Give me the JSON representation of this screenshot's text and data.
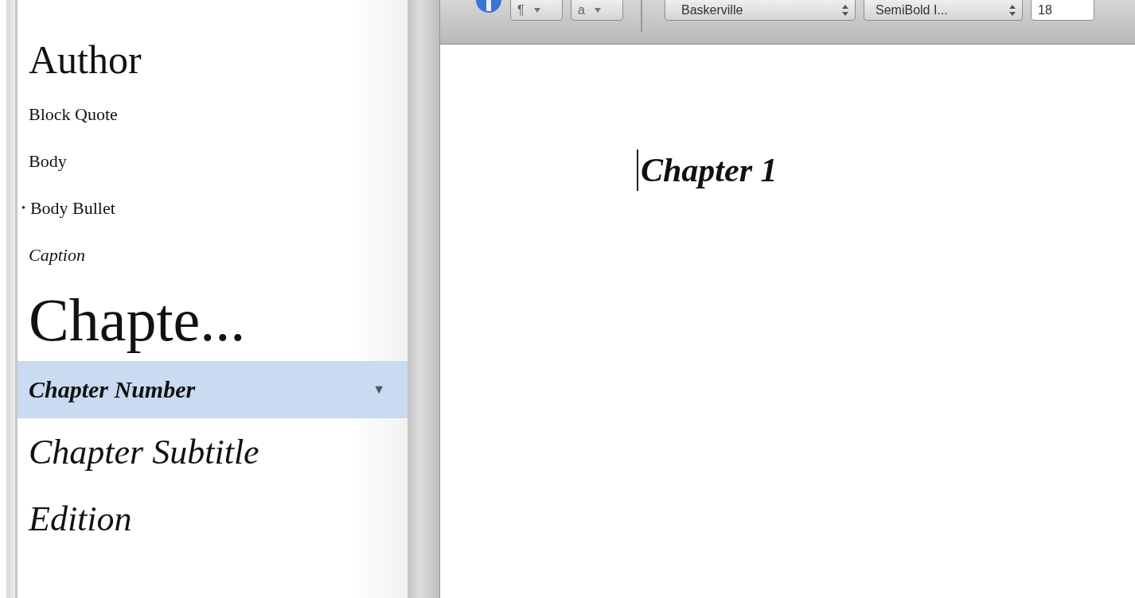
{
  "styles": [
    {
      "label": "Author",
      "kind": "title",
      "selected": false
    },
    {
      "label": "Block Quote",
      "kind": "small",
      "selected": false
    },
    {
      "label": "Body",
      "kind": "small",
      "selected": false
    },
    {
      "label": "Body Bullet",
      "kind": "bullet",
      "bullet": "•",
      "selected": false
    },
    {
      "label": "Caption",
      "kind": "small-italic",
      "selected": false
    },
    {
      "label": "Chapte...",
      "kind": "huge",
      "selected": false
    },
    {
      "label": "Chapter Number",
      "kind": "bold-italic",
      "selected": true,
      "menu": "▼"
    },
    {
      "label": "Chapter Subtitle",
      "kind": "large-italic",
      "selected": false
    },
    {
      "label": "Edition",
      "kind": "large-italic",
      "selected": false
    }
  ],
  "toolbar": {
    "paragraph_button": "¶",
    "character_button": "a",
    "font_family": "Baskerville",
    "font_style": "SemiBold I...",
    "font_size": "18"
  },
  "document": {
    "text": "Chapter 1"
  }
}
